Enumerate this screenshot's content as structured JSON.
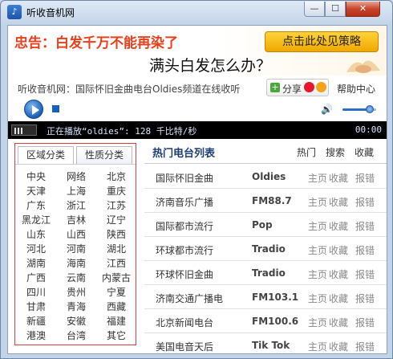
{
  "window": {
    "title": "听收音机网",
    "logo_glyph": "♪"
  },
  "banner": {
    "warning": "忠告：白发千万不能再染了",
    "cta": "点击此处见策略",
    "question": "满头白发怎么办？"
  },
  "info": {
    "description": "听收音机网：国际怀旧金曲电台Oldies频道在线收听",
    "share_label": "分享",
    "help_label": "帮助中心"
  },
  "player": {
    "volume_level": 0.8,
    "volume_glyph": "🔊"
  },
  "status": {
    "text": "正在播放“oldies”: 128 千比特/秒",
    "time": "00:00"
  },
  "categories": {
    "tabs": [
      "区域分类",
      "性质分类"
    ],
    "active_tab": 0,
    "regions": [
      "中央",
      "网络",
      "北京",
      "天津",
      "上海",
      "重庆",
      "广东",
      "浙江",
      "江苏",
      "黑龙江",
      "吉林",
      "辽宁",
      "山东",
      "山西",
      "陕西",
      "河北",
      "河南",
      "湖北",
      "湖南",
      "海南",
      "江西",
      "广西",
      "云南",
      "内蒙古",
      "四川",
      "贵州",
      "宁夏",
      "甘肃",
      "青海",
      "西藏",
      "新疆",
      "安徽",
      "福建",
      "港澳",
      "台湾",
      "其它"
    ]
  },
  "station_list": {
    "title": "热门电台列表",
    "tabs": [
      "热门",
      "搜索",
      "收藏"
    ],
    "actions": [
      "主页",
      "收藏",
      "报错"
    ],
    "stations": [
      {
        "name": "国际怀旧金曲",
        "freq": "Oldies"
      },
      {
        "name": "济南音乐广播",
        "freq": "FM88.7"
      },
      {
        "name": "国际都市流行",
        "freq": "Pop"
      },
      {
        "name": "环球都市流行",
        "freq": "Tradio"
      },
      {
        "name": "环球怀旧金曲",
        "freq": "Tradio"
      },
      {
        "name": "济南交通广播电",
        "freq": "FM103.1"
      },
      {
        "name": "北京新闻电台",
        "freq": "FM100.6"
      },
      {
        "name": "美国电音天后",
        "freq": "Tik Tok"
      }
    ]
  }
}
